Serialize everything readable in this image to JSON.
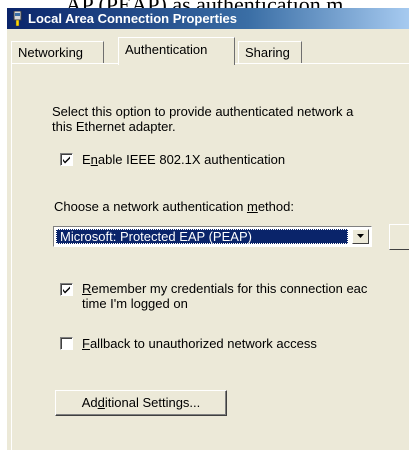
{
  "window": {
    "title": "Local Area Connection Properties"
  },
  "heading_fragment": "AP (PEAP) as authentication m",
  "tabs": [
    {
      "label": "Networking",
      "active": false
    },
    {
      "label": "Authentication",
      "active": true
    },
    {
      "label": "Sharing",
      "active": false
    }
  ],
  "authentication": {
    "description_line1": "Select this option to provide authenticated network a",
    "description_line2": "this Ethernet adapter.",
    "enable_8021x": {
      "label_pre": "E",
      "label_key": "n",
      "label_post": "able IEEE 802.1X authentication",
      "checked": true
    },
    "method_label_pre": "Choose a network authentication ",
    "method_label_key": "m",
    "method_label_post": "ethod:",
    "method_selected": "Microsoft: Protected EAP (PEAP)",
    "remember_credentials": {
      "label_key": "R",
      "label_line1_post": "emember my credentials for this connection eac",
      "label_line2": "time I'm logged on",
      "checked": true
    },
    "fallback": {
      "label_key": "F",
      "label_post": "allback to unauthorized network access",
      "checked": false
    },
    "additional_settings": {
      "label_pre": "Ad",
      "label_key": "d",
      "label_post": "itional Settings..."
    }
  },
  "colors": {
    "titlebar_start": "#0a246a",
    "titlebar_end": "#a6caf0",
    "dialog_face": "#ece9d8",
    "selection": "#0a246a"
  }
}
